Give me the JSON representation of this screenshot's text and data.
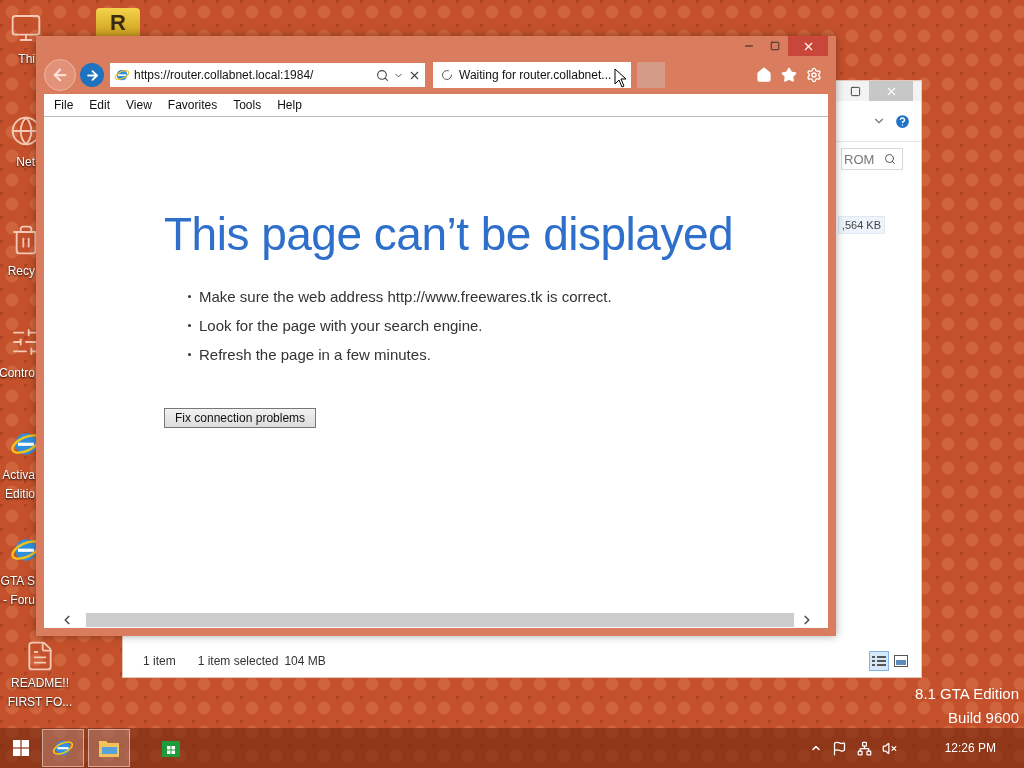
{
  "desktop_icons": [
    {
      "kind": "computer",
      "lines": [
        "Thi"
      ]
    },
    {
      "kind": "network",
      "lines": [
        "Net"
      ]
    },
    {
      "kind": "recycle",
      "lines": [
        "Recy"
      ]
    },
    {
      "kind": "control",
      "lines": [
        "Contro"
      ]
    },
    {
      "kind": "browser",
      "lines": [
        "Activa",
        "Editio"
      ]
    },
    {
      "kind": "browser",
      "lines": [
        "GTA S",
        "- Foru"
      ]
    },
    {
      "kind": "document",
      "lines": [
        "README!!",
        "FIRST FO..."
      ]
    }
  ],
  "app_badge": {
    "glyph": "R"
  },
  "browser": {
    "address": "https://router.collabnet.local:1984/",
    "tab": {
      "title": "Waiting for router.collabnet...",
      "loading": true
    },
    "menu": [
      "File",
      "Edit",
      "View",
      "Favorites",
      "Tools",
      "Help"
    ],
    "page": {
      "heading": "This page can’t be displayed",
      "tips": [
        "Make sure the web address http://www.freewares.tk is correct.",
        "Look for the page with your search engine.",
        "Refresh the page in a few minutes."
      ],
      "button": "Fix connection problems"
    }
  },
  "explorer": {
    "search_placeholder": "ROM",
    "size_cell": ",564 KB",
    "status": [
      "1 item",
      "1 item selected",
      "104 MB"
    ],
    "views": [
      {
        "kind": "details",
        "selected": true
      },
      {
        "kind": "tiles",
        "selected": false
      }
    ]
  },
  "desktop_info": [
    "8.1 GTA Edition",
    "Build 9600"
  ],
  "taskbar": {
    "apps": [
      {
        "kind": "browser",
        "open": true
      },
      {
        "kind": "folder",
        "open": true
      },
      {
        "kind": "store",
        "open": false
      }
    ],
    "clock": "12:26 PM"
  }
}
